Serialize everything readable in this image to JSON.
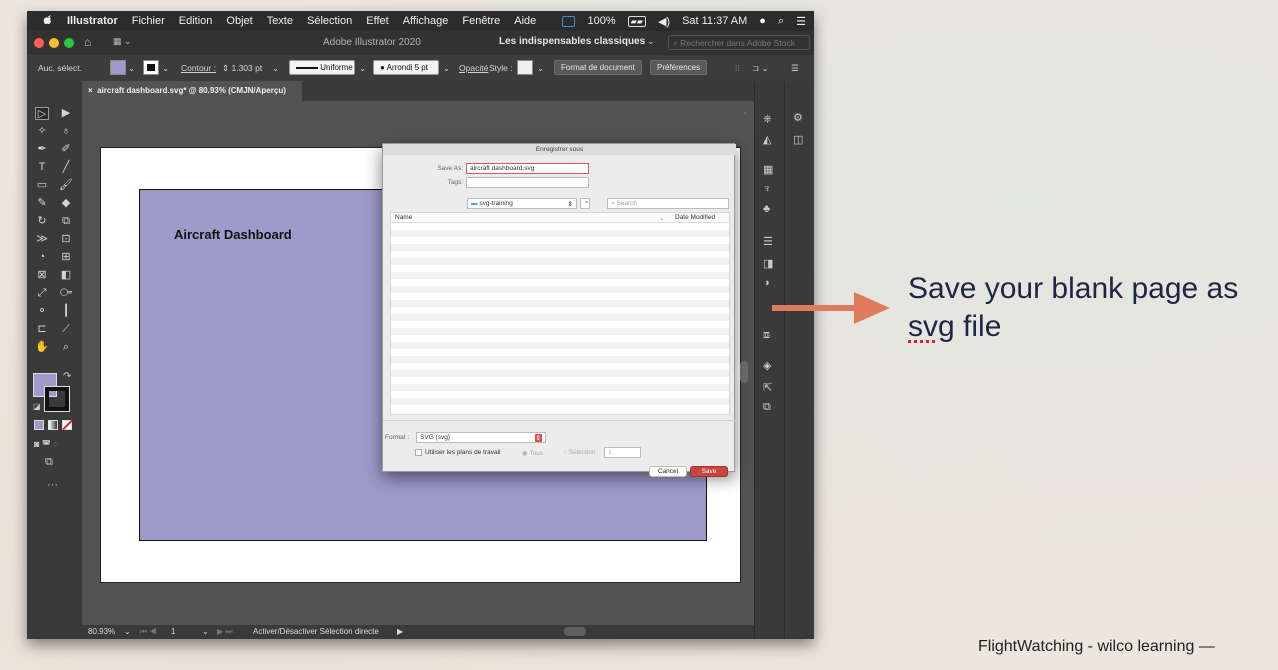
{
  "menubar": {
    "app": "Illustrator",
    "items": [
      "Fichier",
      "Edition",
      "Objet",
      "Texte",
      "Sélection",
      "Effet",
      "Affichage",
      "Fenêtre",
      "Aide"
    ],
    "battery": "100%",
    "clock": "Sat 11:37 AM"
  },
  "titlebar": {
    "title": "Adobe Illustrator 2020",
    "workspace": "Les indispensables classiques",
    "search_placeholder": "Rechercher dans Adobe Stock"
  },
  "control_bar": {
    "selection": "Auc. sélect.",
    "contour_label": "Contour :",
    "stroke_weight": "1.303 pt",
    "stroke_style": "Uniforme",
    "brush": "Arrondi 5 pt",
    "opacity_label": "Opacité",
    "style_label": "Style :",
    "doc_format_button": "Format de document",
    "preferences_button": "Préférences"
  },
  "document_tab": "aircraft dashboard.svg* @ 80.93% (CMJN/Aperçu)",
  "artboard": {
    "title": "Aircraft Dashboard",
    "fill_color": "#9e9bcb"
  },
  "dialog": {
    "title": "Enregistrer sous",
    "save_as_label": "Save As:",
    "save_as_value": "aircraft dashboard.svg",
    "tags_label": "Tags:",
    "folder": "svg-training",
    "search_placeholder": "Search",
    "col_name": "Name",
    "col_date": "Date Modified",
    "format_label": "Format :",
    "format_value": "SVG (svg)",
    "artboards_option": "Utiliser les plans de travail",
    "all_option": "Tous",
    "range_option": "Sélection",
    "range_value": "1",
    "cancel_button": "Cancel",
    "save_button": "Save"
  },
  "status_bar": {
    "zoom": "80.93%",
    "artboard_number": "1",
    "status_text": "Activer/Désactiver Sélection directe"
  },
  "annotation": {
    "text_before": "Save your blank page as ",
    "text_underlined": "svg",
    "text_after": " file",
    "arrow_color": "#e07a5f"
  },
  "footer": "FlightWatching - wilco learning —"
}
